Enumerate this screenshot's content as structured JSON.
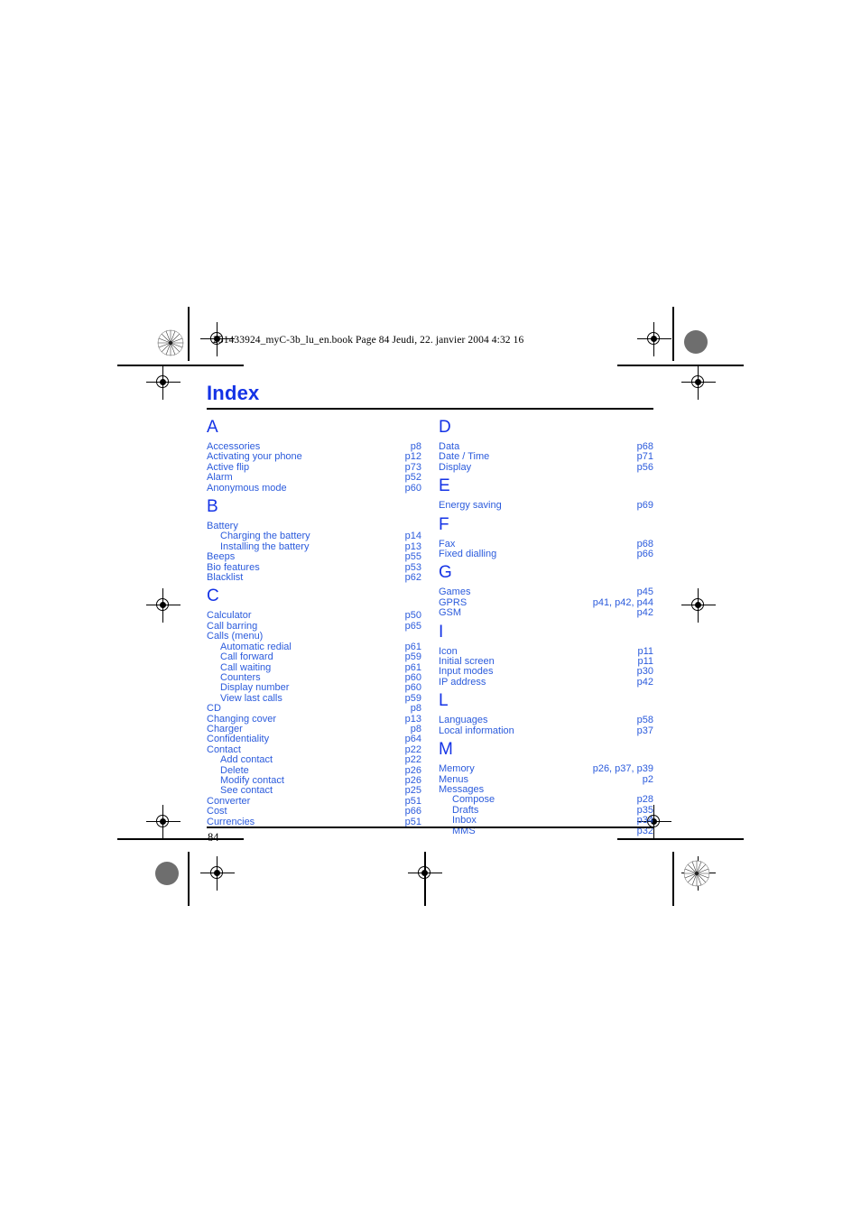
{
  "print_header": {
    "text": "251433924_myC-3b_lu_en.book  Page 84  Jeudi, 22. janvier 2004  4:32 16"
  },
  "page": {
    "title": "Index",
    "folio": "84",
    "title_color": "#1433e6",
    "entry_color": "#2b5bdc"
  },
  "columns": [
    {
      "name": "left-column",
      "sections": [
        {
          "letter": "A",
          "entries": [
            {
              "label": "Accessories",
              "refs": "p8",
              "sub": false
            },
            {
              "label": "Activating your phone",
              "refs": "p12",
              "sub": false
            },
            {
              "label": "Active flip",
              "refs": "p73",
              "sub": false
            },
            {
              "label": "Alarm",
              "refs": "p52",
              "sub": false
            },
            {
              "label": "Anonymous mode",
              "refs": "p60",
              "sub": false
            }
          ]
        },
        {
          "letter": "B",
          "entries": [
            {
              "label": "Battery",
              "refs": "",
              "sub": false
            },
            {
              "label": "Charging the battery",
              "refs": "p14",
              "sub": true
            },
            {
              "label": "Installing the battery",
              "refs": "p13",
              "sub": true
            },
            {
              "label": "Beeps",
              "refs": "p55",
              "sub": false
            },
            {
              "label": "Bio features",
              "refs": "p53",
              "sub": false
            },
            {
              "label": "Blacklist",
              "refs": "p62",
              "sub": false
            }
          ]
        },
        {
          "letter": "C",
          "entries": [
            {
              "label": "Calculator",
              "refs": "p50",
              "sub": false
            },
            {
              "label": "Call barring",
              "refs": "p65",
              "sub": false
            },
            {
              "label": "Calls (menu)",
              "refs": "",
              "sub": false
            },
            {
              "label": "Automatic redial",
              "refs": "p61",
              "sub": true
            },
            {
              "label": "Call forward",
              "refs": "p59",
              "sub": true
            },
            {
              "label": "Call waiting",
              "refs": "p61",
              "sub": true
            },
            {
              "label": "Counters",
              "refs": "p60",
              "sub": true
            },
            {
              "label": "Display number",
              "refs": "p60",
              "sub": true
            },
            {
              "label": "View last calls",
              "refs": "p59",
              "sub": true
            },
            {
              "label": "CD",
              "refs": "p8",
              "sub": false
            },
            {
              "label": "Changing cover",
              "refs": "p13",
              "sub": false
            },
            {
              "label": "Charger",
              "refs": "p8",
              "sub": false
            },
            {
              "label": "Confidentiality",
              "refs": "p64",
              "sub": false
            },
            {
              "label": "Contact",
              "refs": "p22",
              "sub": false
            },
            {
              "label": "Add contact",
              "refs": "p22",
              "sub": true
            },
            {
              "label": "Delete",
              "refs": "p26",
              "sub": true
            },
            {
              "label": "Modify contact",
              "refs": "p26",
              "sub": true
            },
            {
              "label": "See contact",
              "refs": "p25",
              "sub": true
            },
            {
              "label": "Converter",
              "refs": "p51",
              "sub": false
            },
            {
              "label": "Cost",
              "refs": "p66",
              "sub": false
            },
            {
              "label": "Currencies",
              "refs": "p51",
              "sub": false
            }
          ]
        }
      ]
    },
    {
      "name": "right-column",
      "sections": [
        {
          "letter": "D",
          "entries": [
            {
              "label": "Data",
              "refs": "p68",
              "sub": false
            },
            {
              "label": "Date / Time",
              "refs": "p71",
              "sub": false
            },
            {
              "label": "Display",
              "refs": "p56",
              "sub": false
            }
          ]
        },
        {
          "letter": "E",
          "entries": [
            {
              "label": "Energy saving",
              "refs": "p69",
              "sub": false
            }
          ]
        },
        {
          "letter": "F",
          "entries": [
            {
              "label": "Fax",
              "refs": "p68",
              "sub": false
            },
            {
              "label": "Fixed dialling",
              "refs": "p66",
              "sub": false
            }
          ]
        },
        {
          "letter": "G",
          "entries": [
            {
              "label": "Games",
              "refs": "p45",
              "sub": false
            },
            {
              "label": "GPRS",
              "refs": "p41,  p42,  p44",
              "sub": false
            },
            {
              "label": "GSM",
              "refs": "p42",
              "sub": false
            }
          ]
        },
        {
          "letter": "I",
          "entries": [
            {
              "label": "Icon",
              "refs": "p11",
              "sub": false
            },
            {
              "label": "Initial screen",
              "refs": "p11",
              "sub": false
            },
            {
              "label": "Input modes",
              "refs": "p30",
              "sub": false
            },
            {
              "label": "IP address",
              "refs": "p42",
              "sub": false
            }
          ]
        },
        {
          "letter": "L",
          "entries": [
            {
              "label": "Languages",
              "refs": "p58",
              "sub": false
            },
            {
              "label": "Local information",
              "refs": "p37",
              "sub": false
            }
          ]
        },
        {
          "letter": "M",
          "entries": [
            {
              "label": "Memory",
              "refs": "p26,  p37,  p39",
              "sub": false
            },
            {
              "label": "Menus",
              "refs": "p2",
              "sub": false
            },
            {
              "label": "Messages",
              "refs": "",
              "sub": false
            },
            {
              "label": "Compose",
              "refs": "p28",
              "sub": true
            },
            {
              "label": "Drafts",
              "refs": "p35",
              "sub": true
            },
            {
              "label": "Inbox",
              "refs": "p34",
              "sub": true
            },
            {
              "label": "MMS",
              "refs": "p32",
              "sub": true
            }
          ]
        }
      ]
    }
  ]
}
